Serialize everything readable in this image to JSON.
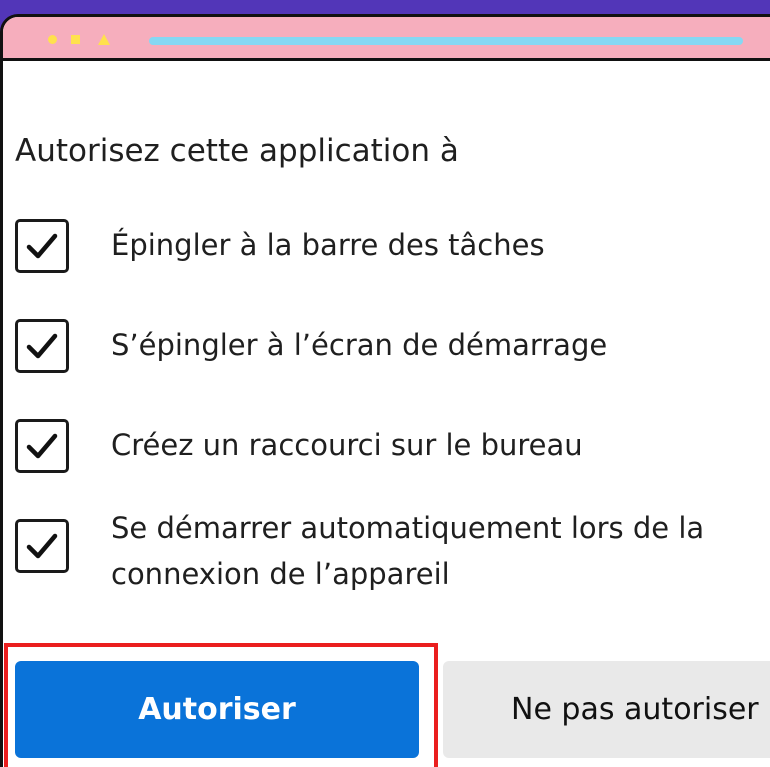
{
  "dialog": {
    "heading": "Autorisez cette application à",
    "permissions": [
      {
        "label": "Épingler à la barre des tâches",
        "checked": true
      },
      {
        "label": "S’épingler à l’écran de démarrage",
        "checked": true
      },
      {
        "label": "Créez un raccourci sur le bureau",
        "checked": true
      },
      {
        "label": "Se démarrer automatiquement lors de la",
        "label_line_2": "connexion de l’appareil",
        "checked": true
      }
    ],
    "buttons": {
      "primary": "Autoriser",
      "secondary": "Ne pas autoriser"
    }
  },
  "colors": {
    "background": "#5236b8",
    "titlebar": "#f6aebd",
    "address_bar": "#86d8f3",
    "primary_button": "#0a73d9",
    "secondary_button": "#e9e9e9",
    "highlight": "#ea1e1e"
  },
  "icons": {
    "window_controls": [
      "circle-icon",
      "square-icon",
      "triangle-icon"
    ],
    "checkbox_mark": "check-icon"
  }
}
